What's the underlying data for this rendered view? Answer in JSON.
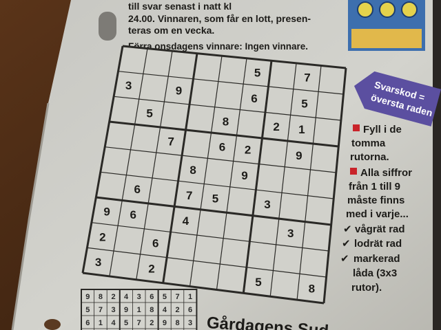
{
  "top_text": {
    "line1": "till svar senast i natt kl",
    "line2": "24.00. Vinnaren, som får en lott, presen-",
    "line3": "teras om en vecka."
  },
  "previous_winner": "Förra onsdagens vinnare: Ingen vinnare.",
  "sudoku": {
    "givens": [
      {
        "r": 0,
        "c": 5,
        "v": "5"
      },
      {
        "r": 0,
        "c": 7,
        "v": "7"
      },
      {
        "r": 1,
        "c": 0,
        "v": "3"
      },
      {
        "r": 1,
        "c": 2,
        "v": "9"
      },
      {
        "r": 1,
        "c": 5,
        "v": "6"
      },
      {
        "r": 1,
        "c": 7,
        "v": "5"
      },
      {
        "r": 2,
        "c": 1,
        "v": "5"
      },
      {
        "r": 2,
        "c": 4,
        "v": "8"
      },
      {
        "r": 2,
        "c": 6,
        "v": "2"
      },
      {
        "r": 2,
        "c": 7,
        "v": "1"
      },
      {
        "r": 3,
        "c": 2,
        "v": "7"
      },
      {
        "r": 3,
        "c": 4,
        "v": "6"
      },
      {
        "r": 3,
        "c": 5,
        "v": "2"
      },
      {
        "r": 3,
        "c": 7,
        "v": "9"
      },
      {
        "r": 4,
        "c": 3,
        "v": "8"
      },
      {
        "r": 4,
        "c": 5,
        "v": "9"
      },
      {
        "r": 5,
        "c": 1,
        "v": "6"
      },
      {
        "r": 5,
        "c": 3,
        "v": "7"
      },
      {
        "r": 5,
        "c": 4,
        "v": "5"
      },
      {
        "r": 5,
        "c": 6,
        "v": "3"
      },
      {
        "r": 6,
        "c": 0,
        "v": "9"
      },
      {
        "r": 6,
        "c": 1,
        "v": "6"
      },
      {
        "r": 6,
        "c": 3,
        "v": "4"
      },
      {
        "r": 6,
        "c": 7,
        "v": "3"
      },
      {
        "r": 7,
        "c": 0,
        "v": "2"
      },
      {
        "r": 7,
        "c": 2,
        "v": "6"
      },
      {
        "r": 8,
        "c": 0,
        "v": "3"
      },
      {
        "r": 8,
        "c": 2,
        "v": "2"
      },
      {
        "r": 8,
        "c": 6,
        "v": "5"
      },
      {
        "r": 8,
        "c": 8,
        "v": "8"
      }
    ]
  },
  "answer_tag": {
    "line1": "Svarskod =",
    "line2": "översta raden"
  },
  "instructions": {
    "fill_lines": [
      "Fyll i de",
      "tomma",
      "rutorna."
    ],
    "all_lines": [
      "Alla siffror",
      "från 1 till 9",
      "måste finns",
      "med i varje..."
    ],
    "checks": [
      "vågrät rad",
      "lodrät rad",
      "markerad"
    ],
    "box_lines": [
      "låda (3x3",
      "rutor)."
    ],
    "check_glyph": "✔"
  },
  "solution_grid": {
    "rows": [
      [
        "9",
        "8",
        "2",
        "4",
        "3",
        "6",
        "5",
        "7",
        "1"
      ],
      [
        "5",
        "7",
        "3",
        "9",
        "1",
        "8",
        "4",
        "2",
        "6"
      ],
      [
        "6",
        "1",
        "4",
        "5",
        "7",
        "2",
        "9",
        "8",
        "3"
      ]
    ]
  },
  "yesterday_heading": "Gårdagens Sud",
  "colors": {
    "paper": "#cbcbc5",
    "ink": "#1c1b18",
    "accent_red": "#c9242a",
    "tag_purple": "#5b4fa0"
  }
}
